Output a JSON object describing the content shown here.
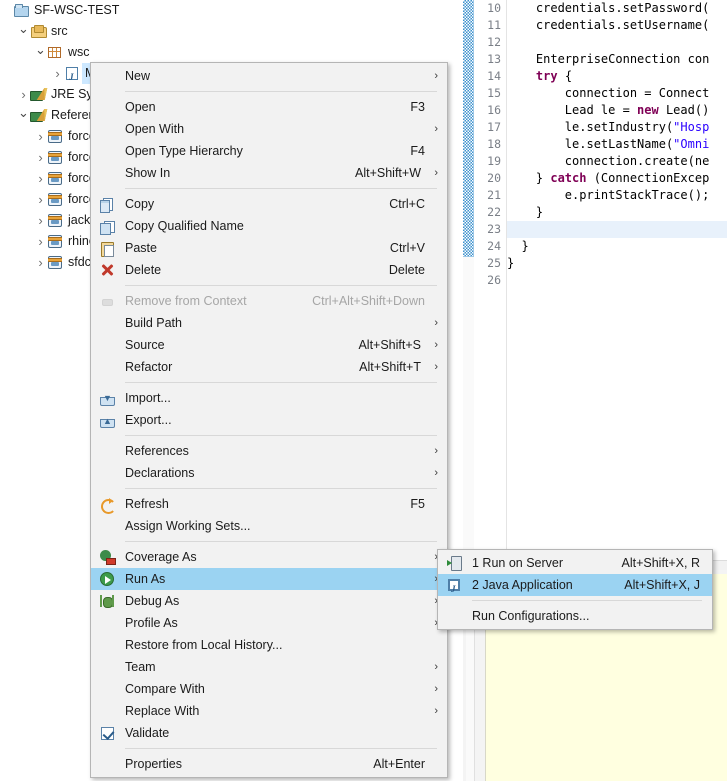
{
  "explorer": {
    "tree": [
      {
        "label": "SF-WSC-TEST",
        "twisty": "",
        "icon": "project-icon",
        "indent": 0,
        "selected": false
      },
      {
        "label": "src",
        "twisty": "v",
        "icon": "source-folder-icon",
        "indent": 1,
        "selected": false
      },
      {
        "label": "wsc",
        "twisty": "v",
        "icon": "package-icon",
        "indent": 2,
        "selected": false
      },
      {
        "label": "Main.iava",
        "twisty": ">",
        "icon": "java-file-icon",
        "indent": 3,
        "selected": true
      },
      {
        "label": "JRE Syster",
        "twisty": ">",
        "icon": "library-icon",
        "indent": 1,
        "selected": false
      },
      {
        "label": "Reference",
        "twisty": "v",
        "icon": "library-icon",
        "indent": 1,
        "selected": false
      },
      {
        "label": "force-w",
        "twisty": ">",
        "icon": "jar-icon",
        "indent": 2,
        "selected": false
      },
      {
        "label": "force-w",
        "twisty": ">",
        "icon": "jar-icon",
        "indent": 2,
        "selected": false
      },
      {
        "label": "force-w",
        "twisty": ">",
        "icon": "jar-icon",
        "indent": 2,
        "selected": false
      },
      {
        "label": "force-w",
        "twisty": ">",
        "icon": "jar-icon",
        "indent": 2,
        "selected": false
      },
      {
        "label": "jackso",
        "twisty": ">",
        "icon": "jar-icon",
        "indent": 2,
        "selected": false
      },
      {
        "label": "rhino-",
        "twisty": ">",
        "icon": "jar-icon",
        "indent": 2,
        "selected": false
      },
      {
        "label": "sfdc_st",
        "twisty": ">",
        "icon": "jar-icon",
        "indent": 2,
        "selected": false
      }
    ]
  },
  "context_menu": {
    "items": [
      {
        "type": "item",
        "label": "New",
        "accel": "",
        "arrow": true,
        "icon": "",
        "disabled": false,
        "highlighted": false
      },
      {
        "type": "separator"
      },
      {
        "type": "item",
        "label": "Open",
        "accel": "F3",
        "arrow": false,
        "icon": "",
        "disabled": false,
        "highlighted": false
      },
      {
        "type": "item",
        "label": "Open With",
        "accel": "",
        "arrow": true,
        "icon": "",
        "disabled": false,
        "highlighted": false
      },
      {
        "type": "item",
        "label": "Open Type Hierarchy",
        "accel": "F4",
        "arrow": false,
        "icon": "",
        "disabled": false,
        "highlighted": false
      },
      {
        "type": "item",
        "label": "Show In",
        "accel": "Alt+Shift+W",
        "arrow": true,
        "icon": "",
        "disabled": false,
        "highlighted": false
      },
      {
        "type": "separator"
      },
      {
        "type": "item",
        "label": "Copy",
        "accel": "Ctrl+C",
        "arrow": false,
        "icon": "copy-icon",
        "disabled": false,
        "highlighted": false
      },
      {
        "type": "item",
        "label": "Copy Qualified Name",
        "accel": "",
        "arrow": false,
        "icon": "copy-qualified-icon",
        "disabled": false,
        "highlighted": false
      },
      {
        "type": "item",
        "label": "Paste",
        "accel": "Ctrl+V",
        "arrow": false,
        "icon": "paste-icon",
        "disabled": false,
        "highlighted": false
      },
      {
        "type": "item",
        "label": "Delete",
        "accel": "Delete",
        "arrow": false,
        "icon": "delete-icon",
        "disabled": false,
        "highlighted": false
      },
      {
        "type": "separator"
      },
      {
        "type": "item",
        "label": "Remove from Context",
        "accel": "Ctrl+Alt+Shift+Down",
        "arrow": false,
        "icon": "remove-context-icon",
        "disabled": true,
        "highlighted": false
      },
      {
        "type": "item",
        "label": "Build Path",
        "accel": "",
        "arrow": true,
        "icon": "",
        "disabled": false,
        "highlighted": false
      },
      {
        "type": "item",
        "label": "Source",
        "accel": "Alt+Shift+S",
        "arrow": true,
        "icon": "",
        "disabled": false,
        "highlighted": false
      },
      {
        "type": "item",
        "label": "Refactor",
        "accel": "Alt+Shift+T",
        "arrow": true,
        "icon": "",
        "disabled": false,
        "highlighted": false
      },
      {
        "type": "separator"
      },
      {
        "type": "item",
        "label": "Import...",
        "accel": "",
        "arrow": false,
        "icon": "import-icon",
        "disabled": false,
        "highlighted": false
      },
      {
        "type": "item",
        "label": "Export...",
        "accel": "",
        "arrow": false,
        "icon": "export-icon",
        "disabled": false,
        "highlighted": false
      },
      {
        "type": "separator"
      },
      {
        "type": "item",
        "label": "References",
        "accel": "",
        "arrow": true,
        "icon": "",
        "disabled": false,
        "highlighted": false
      },
      {
        "type": "item",
        "label": "Declarations",
        "accel": "",
        "arrow": true,
        "icon": "",
        "disabled": false,
        "highlighted": false
      },
      {
        "type": "separator"
      },
      {
        "type": "item",
        "label": "Refresh",
        "accel": "F5",
        "arrow": false,
        "icon": "refresh-icon",
        "disabled": false,
        "highlighted": false
      },
      {
        "type": "item",
        "label": "Assign Working Sets...",
        "accel": "",
        "arrow": false,
        "icon": "",
        "disabled": false,
        "highlighted": false
      },
      {
        "type": "separator"
      },
      {
        "type": "item",
        "label": "Coverage As",
        "accel": "",
        "arrow": true,
        "icon": "coverage-icon",
        "disabled": false,
        "highlighted": false
      },
      {
        "type": "item",
        "label": "Run As",
        "accel": "",
        "arrow": true,
        "icon": "run-icon",
        "disabled": false,
        "highlighted": true
      },
      {
        "type": "item",
        "label": "Debug As",
        "accel": "",
        "arrow": true,
        "icon": "debug-icon",
        "disabled": false,
        "highlighted": false
      },
      {
        "type": "item",
        "label": "Profile As",
        "accel": "",
        "arrow": true,
        "icon": "",
        "disabled": false,
        "highlighted": false
      },
      {
        "type": "item",
        "label": "Restore from Local History...",
        "accel": "",
        "arrow": false,
        "icon": "",
        "disabled": false,
        "highlighted": false
      },
      {
        "type": "item",
        "label": "Team",
        "accel": "",
        "arrow": true,
        "icon": "",
        "disabled": false,
        "highlighted": false
      },
      {
        "type": "item",
        "label": "Compare With",
        "accel": "",
        "arrow": true,
        "icon": "",
        "disabled": false,
        "highlighted": false
      },
      {
        "type": "item",
        "label": "Replace With",
        "accel": "",
        "arrow": true,
        "icon": "",
        "disabled": false,
        "highlighted": false
      },
      {
        "type": "item",
        "label": "Validate",
        "accel": "",
        "arrow": false,
        "icon": "checkbox-checked-icon",
        "disabled": false,
        "highlighted": false
      },
      {
        "type": "separator"
      },
      {
        "type": "item",
        "label": "Properties",
        "accel": "Alt+Enter",
        "arrow": false,
        "icon": "",
        "disabled": false,
        "highlighted": false
      }
    ]
  },
  "run_as_submenu": {
    "items": [
      {
        "type": "item",
        "label": "1 Run on Server",
        "accel": "Alt+Shift+X, R",
        "icon": "run-on-server-icon",
        "highlighted": false
      },
      {
        "type": "item",
        "label": "2 Java Application",
        "accel": "Alt+Shift+X, J",
        "icon": "java-application-icon",
        "highlighted": true
      },
      {
        "type": "separator"
      },
      {
        "type": "item",
        "label": "Run Configurations...",
        "accel": "",
        "icon": "",
        "highlighted": false
      }
    ]
  },
  "editor": {
    "first_line_number": 10,
    "lines": [
      {
        "n": "10",
        "text": "    credentials.setPassword(",
        "highlighted": false
      },
      {
        "n": "11",
        "text": "    credentials.setUsername(",
        "highlighted": false
      },
      {
        "n": "12",
        "text": "",
        "highlighted": false
      },
      {
        "n": "13",
        "text": "    EnterpriseConnection con",
        "highlighted": false
      },
      {
        "n": "14",
        "text": "    try {",
        "highlighted": false
      },
      {
        "n": "15",
        "text": "        connection = Connect",
        "highlighted": false
      },
      {
        "n": "16",
        "text": "        Lead le = new Lead()",
        "highlighted": false
      },
      {
        "n": "17",
        "text": "        le.setIndustry(\"Hosp",
        "highlighted": false
      },
      {
        "n": "18",
        "text": "        le.setLastName(\"Omni",
        "highlighted": false
      },
      {
        "n": "19",
        "text": "        connection.create(ne",
        "highlighted": false
      },
      {
        "n": "20",
        "text": "    } catch (ConnectionExcep",
        "highlighted": false
      },
      {
        "n": "21",
        "text": "        e.printStackTrace();",
        "highlighted": false
      },
      {
        "n": "22",
        "text": "    }",
        "highlighted": false
      },
      {
        "n": "23",
        "text": "",
        "highlighted": true
      },
      {
        "n": "24",
        "text": "  }",
        "highlighted": false
      },
      {
        "n": "25",
        "text": "}",
        "highlighted": false
      },
      {
        "n": "26",
        "text": "",
        "highlighted": false
      }
    ]
  },
  "colors": {
    "menu_background": "#f2f2f2",
    "menu_highlight": "#9bd3f2",
    "tree_selection": "#cde8ff",
    "console_background": "#ffffe0",
    "keyword": "#7f0055",
    "string": "#2a00ff",
    "line_number": "#7a7f87",
    "current_line": "#e8f1fb"
  }
}
